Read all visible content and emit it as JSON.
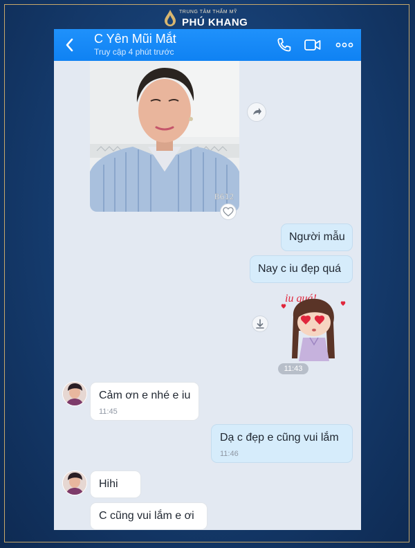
{
  "brand": {
    "small_text": "TRUNG TÂM THẨM MỸ",
    "name": "PHÚ KHANG"
  },
  "header": {
    "contact_name": "C Yên Mũi Mắt",
    "status": "Truy cập 4 phút trước",
    "icons": [
      "back-arrow-icon",
      "phone-icon",
      "video-call-icon",
      "more-icon"
    ]
  },
  "photo": {
    "watermark": "B612"
  },
  "messages": [
    {
      "direction": "out",
      "text": "Người mẫu"
    },
    {
      "direction": "out",
      "text": "Nay c iu đẹp quá"
    },
    {
      "direction": "out",
      "type": "sticker",
      "sticker_text": "iu quá!",
      "time": "11:43"
    },
    {
      "direction": "in",
      "text": "Cảm ơn e nhé e iu",
      "time": "11:45"
    },
    {
      "direction": "out",
      "text": "Dạ c đẹp e cũng vui lắm",
      "time": "11:46"
    },
    {
      "direction": "in",
      "text": "Hihi"
    },
    {
      "direction": "in",
      "text": "C cũng vui lắm e ơi"
    }
  ],
  "colors": {
    "header_blue": "#1089f5",
    "outgoing_bubble": "#d6ecfb",
    "incoming_bubble": "#ffffff",
    "chat_background": "#e3e9f2"
  }
}
